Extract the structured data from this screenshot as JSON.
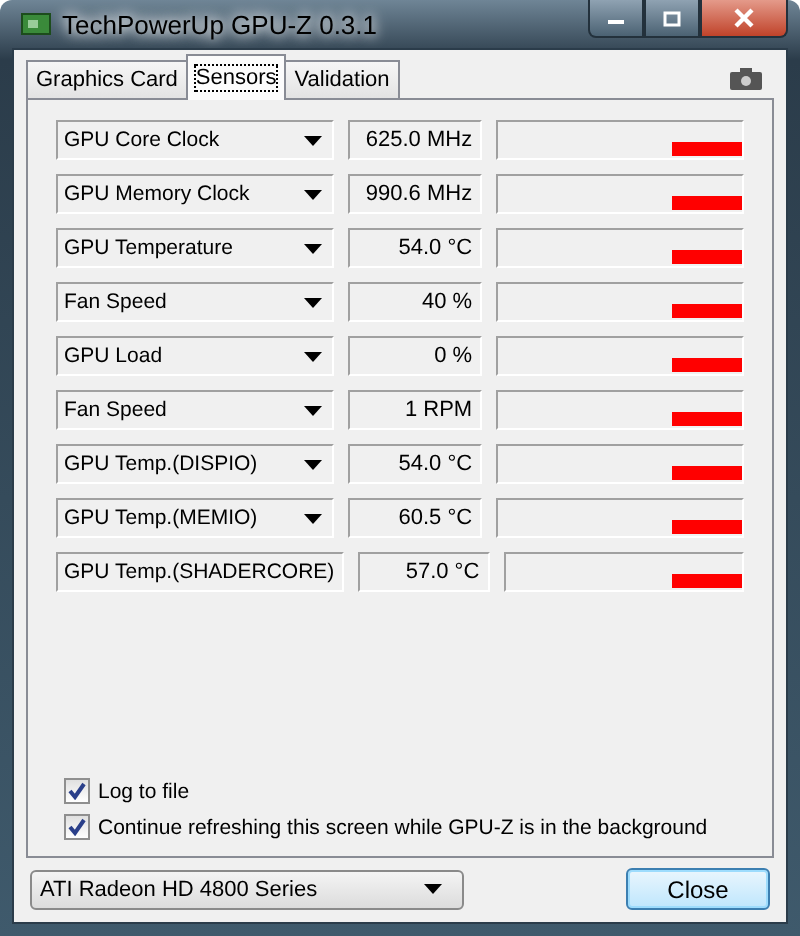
{
  "window": {
    "title": "TechPowerUp GPU-Z 0.3.1"
  },
  "tabs": [
    {
      "label": "Graphics Card",
      "selected": false
    },
    {
      "label": "Sensors",
      "selected": true
    },
    {
      "label": "Validation",
      "selected": false
    }
  ],
  "sensors": [
    {
      "name": "GPU Core Clock",
      "reading": "625.0 MHz"
    },
    {
      "name": "GPU Memory Clock",
      "reading": "990.6 MHz"
    },
    {
      "name": "GPU Temperature",
      "reading": "54.0 °C"
    },
    {
      "name": "Fan Speed",
      "reading": "40 %"
    },
    {
      "name": "GPU Load",
      "reading": "0 %"
    },
    {
      "name": "Fan Speed",
      "reading": "1 RPM"
    },
    {
      "name": "GPU Temp.(DISPIO)",
      "reading": "54.0 °C"
    },
    {
      "name": "GPU Temp.(MEMIO)",
      "reading": "60.5 °C"
    },
    {
      "name": "GPU Temp.(SHADERCORE)",
      "reading": "57.0 °C"
    }
  ],
  "options": [
    {
      "label": "Log to file",
      "checked": true
    },
    {
      "label": "Continue refreshing this screen while GPU-Z is in the background",
      "checked": true
    }
  ],
  "card_select": {
    "value": "ATI Radeon HD 4800 Series"
  },
  "buttons": [
    "Close"
  ]
}
